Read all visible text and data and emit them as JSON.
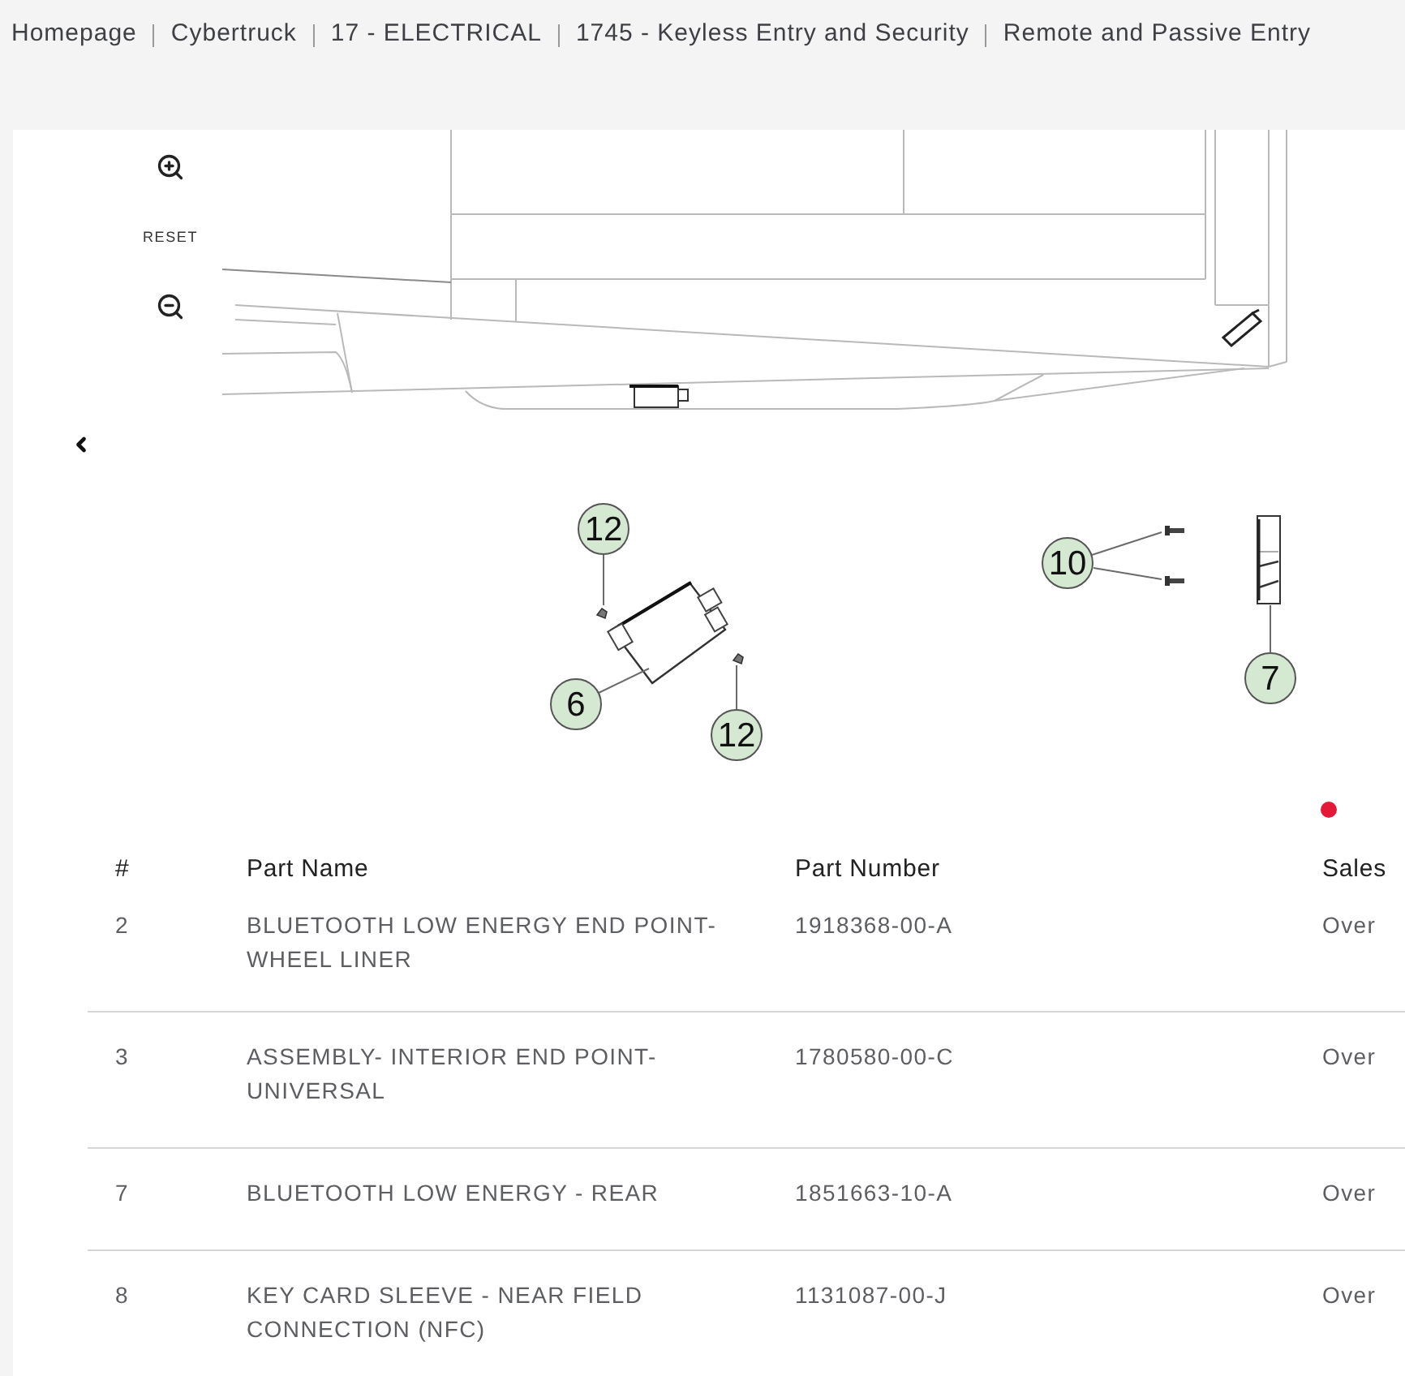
{
  "breadcrumb": [
    "Homepage",
    "Cybertruck",
    "17 - ELECTRICAL",
    "1745 - Keyless Entry and Security",
    "Remote and Passive Entry"
  ],
  "diagram": {
    "reset_label": "RESET",
    "callouts": [
      "12",
      "6",
      "12",
      "10",
      "7"
    ]
  },
  "table": {
    "columns": [
      "#",
      "Part Name",
      "Part Number",
      "Sales"
    ],
    "rows": [
      {
        "cells": [
          "2",
          "BLUETOOTH LOW ENERGY END POINT- WHEEL LINER",
          "1918368-00-A",
          "Over"
        ]
      },
      {
        "cells": [
          "3",
          "ASSEMBLY- INTERIOR END POINT- UNIVERSAL",
          "1780580-00-C",
          "Over"
        ]
      },
      {
        "cells": [
          "7",
          "BLUETOOTH LOW ENERGY - REAR",
          "1851663-10-A",
          "Over"
        ]
      },
      {
        "cells": [
          "8",
          "KEY CARD SLEEVE - NEAR FIELD CONNECTION (NFC)",
          "1131087-00-J",
          "Over"
        ]
      }
    ]
  }
}
